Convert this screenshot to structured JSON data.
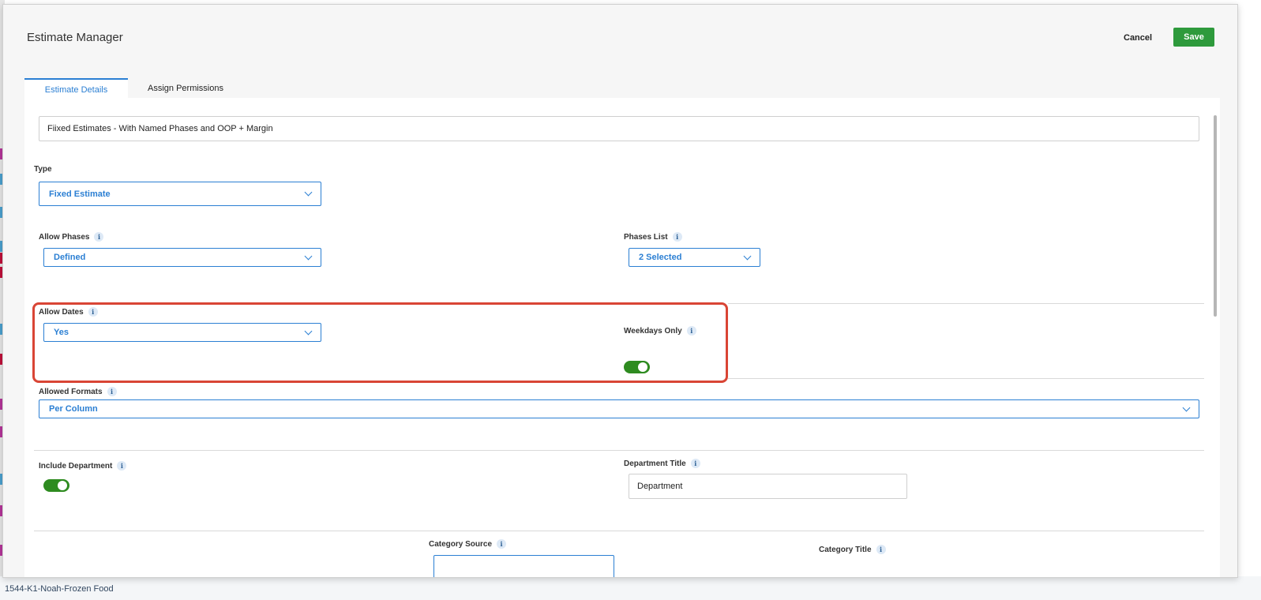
{
  "background": {
    "rows": [
      "1544-K1-Noah-Frozen Food"
    ]
  },
  "modal": {
    "title": "Estimate Manager",
    "cancel_label": "Cancel",
    "save_label": "Save"
  },
  "tabs": [
    {
      "label": "Estimate Details",
      "active": true
    },
    {
      "label": "Assign Permissions",
      "active": false
    }
  ],
  "form": {
    "estimate_name": "Fiixed Estimates - With Named Phases and OOP + Margin",
    "type": {
      "label": "Type",
      "value": "Fixed Estimate"
    },
    "allow_phases": {
      "label": "Allow Phases",
      "value": "Defined"
    },
    "phases_list": {
      "label": "Phases List",
      "value": "2 Selected"
    },
    "allow_dates": {
      "label": "Allow Dates",
      "value": "Yes"
    },
    "weekdays_only": {
      "label": "Weekdays Only",
      "on": true
    },
    "allowed_formats": {
      "label": "Allowed Formats",
      "value": "Per Column"
    },
    "include_department": {
      "label": "Include Department",
      "on": true
    },
    "department_title": {
      "label": "Department Title",
      "value": "Department"
    },
    "category_source": {
      "label": "Category Source"
    },
    "category_title": {
      "label": "Category Title"
    }
  },
  "colors": {
    "accent": "#2b7fd3",
    "save": "#2e9a3c",
    "toggle_on": "#2e8b20",
    "highlight": "#d94535"
  },
  "icons": {
    "info": "i"
  }
}
